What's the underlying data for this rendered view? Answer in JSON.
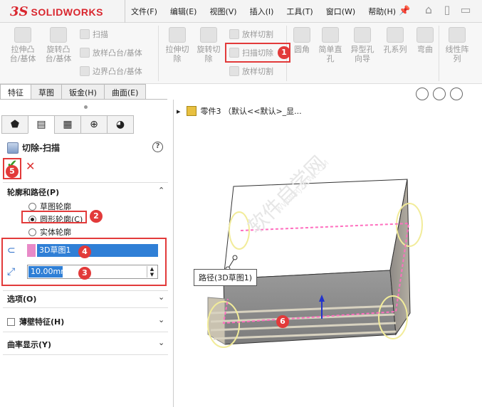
{
  "app": {
    "logo_mark": "3S",
    "logo_text": "SOLIDWORKS"
  },
  "menu": [
    "文件(F)",
    "编辑(E)",
    "视图(V)",
    "插入(I)",
    "工具(T)",
    "窗口(W)",
    "帮助(H)"
  ],
  "title_icons": [
    "home-icon",
    "document-icon",
    "folder-open-icon"
  ],
  "ribbon": {
    "big": [
      {
        "label1": "拉伸凸",
        "label2": "台/基体"
      },
      {
        "label1": "旋转凸",
        "label2": "台/基体"
      },
      {
        "label1": "拉伸切",
        "label2": "除"
      },
      {
        "label1": "旋转切",
        "label2": "除"
      },
      {
        "label1": "圆角",
        "label2": ""
      },
      {
        "label1": "简单直",
        "label2": "孔"
      },
      {
        "label1": "异型孔",
        "label2": "向导"
      },
      {
        "label1": "孔系列",
        "label2": ""
      },
      {
        "label1": "弯曲",
        "label2": ""
      },
      {
        "label1": "线性阵",
        "label2": "列"
      }
    ],
    "small_left": [
      "扫描",
      "放样凸台/基体",
      "边界凸台/基体"
    ],
    "small_right": [
      "放样切割",
      "扫描切除",
      "放样切割"
    ]
  },
  "tabs": [
    "特征",
    "草图",
    "钣金(H)",
    "曲面(E)"
  ],
  "property_manager": {
    "title": "切除-扫描",
    "help": "?",
    "section_profile": "轮廓和路径(P)",
    "radios": [
      "草图轮廓",
      "圆形轮廓(C)",
      "实体轮廓"
    ],
    "selected_radio": 1,
    "path_value": "3D草图1",
    "diameter_value": "10.00mm",
    "section_options": "选项(O)",
    "thin_feature": "薄壁特征(H)",
    "curvature": "曲率显示(Y)"
  },
  "badges": [
    "1",
    "2",
    "3",
    "4",
    "5",
    "6"
  ],
  "viewport": {
    "tree_label": "零件3 （默认<<默认>_显...",
    "tooltip": "路径(3D草图1)",
    "watermark": "软件自学网",
    "watermark_url": "WWW.RJZXW.COM"
  }
}
